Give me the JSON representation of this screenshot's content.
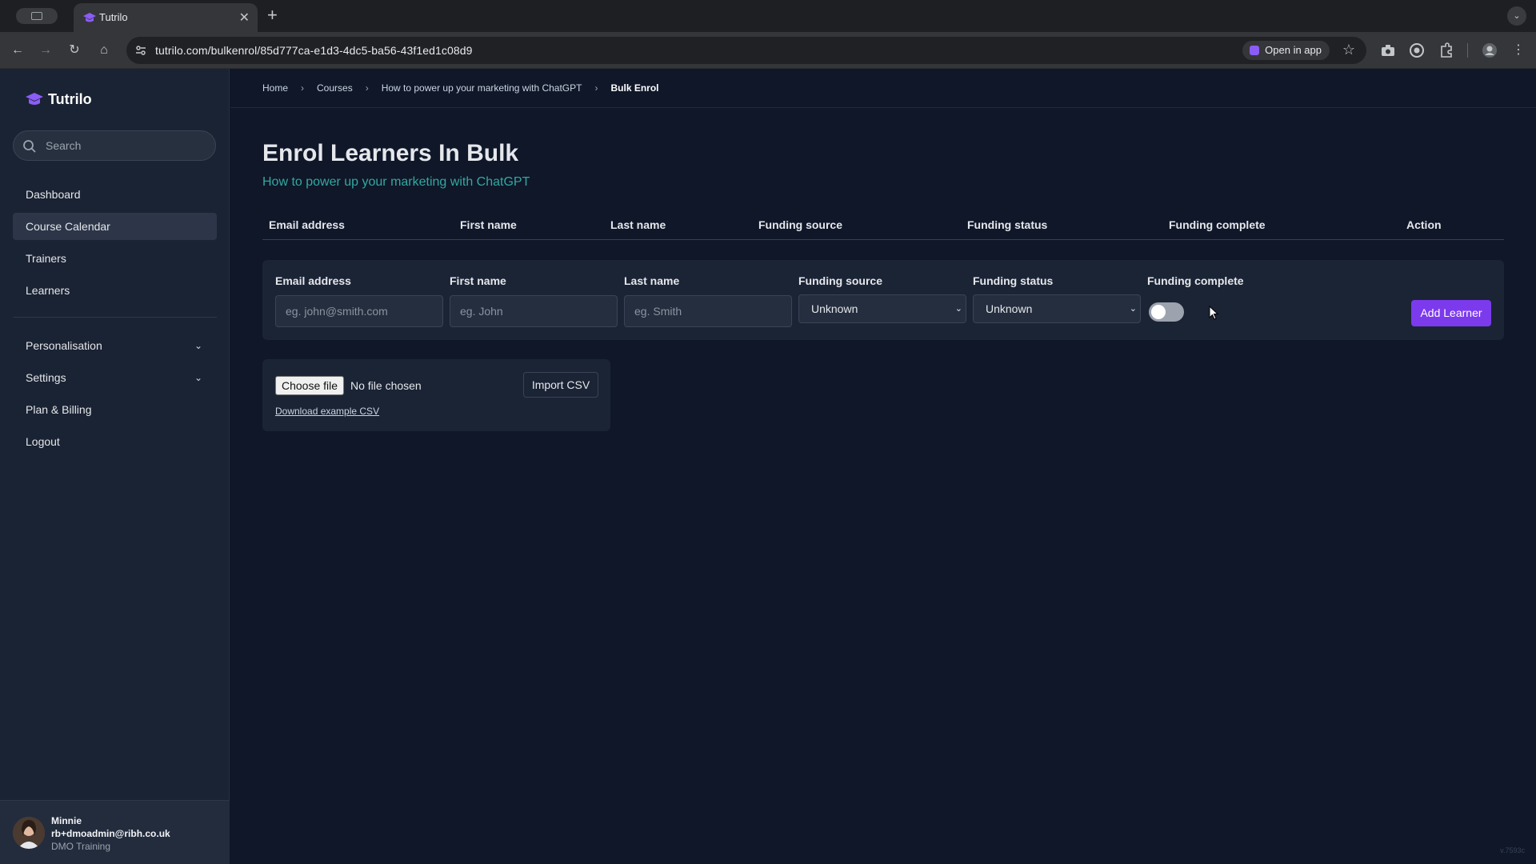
{
  "browser": {
    "tab_title": "Tutrilo",
    "tab_close": "✕",
    "new_tab": "+",
    "url": "tutrilo.com/bulkenrol/85d777ca-e1d3-4dc5-ba56-43f1ed1c08d9",
    "open_in_app": "Open in app",
    "icons": [
      "back-icon",
      "forward-icon",
      "reload-icon",
      "home-icon",
      "site-settings-icon",
      "star-icon",
      "camera-icon",
      "profile-circle-icon",
      "extensions-icon",
      "account-icon",
      "menu-icon"
    ]
  },
  "sidebar": {
    "brand": "Tutrilo",
    "brand_color": "#8b5cf6",
    "search_placeholder": "Search",
    "items": [
      {
        "label": "Dashboard"
      },
      {
        "label": "Course Calendar",
        "active": true
      },
      {
        "label": "Trainers"
      },
      {
        "label": "Learners"
      },
      {
        "label": "Personalisation",
        "chevron": "⌄"
      },
      {
        "label": "Settings",
        "chevron": "⌄"
      },
      {
        "label": "Plan & Billing"
      },
      {
        "label": "Logout"
      }
    ],
    "user": {
      "name": "Minnie",
      "email": "rb+dmoadmin@ribh.co.uk",
      "org": "DMO Training"
    }
  },
  "breadcrumb": {
    "home": "Home",
    "courses": "Courses",
    "course": "How to power up your marketing with ChatGPT",
    "current": "Bulk Enrol",
    "separator": "›"
  },
  "page": {
    "title": "Enrol Learners In Bulk",
    "subtitle": "How to power up your marketing with ChatGPT",
    "subtitle_color": "#34a8a0"
  },
  "table": {
    "headers": [
      "Email address",
      "First name",
      "Last name",
      "Funding source",
      "Funding status",
      "Funding complete",
      "Action"
    ]
  },
  "form": {
    "email_label": "Email address",
    "email_placeholder": "eg. john@smith.com",
    "first_label": "First name",
    "first_placeholder": "eg. John",
    "last_label": "Last name",
    "last_placeholder": "eg. Smith",
    "funding_source_label": "Funding source",
    "funding_source_value": "Unknown",
    "funding_status_label": "Funding status",
    "funding_status_value": "Unknown",
    "funding_complete_label": "Funding complete",
    "funding_complete_on": false,
    "add_button": "Add Learner",
    "accent_color": "#7c3aed"
  },
  "csv": {
    "choose_file": "Choose file",
    "no_file": "No file chosen",
    "import_button": "Import CSV",
    "download_link": "Download example CSV"
  },
  "version": "v.7593c"
}
